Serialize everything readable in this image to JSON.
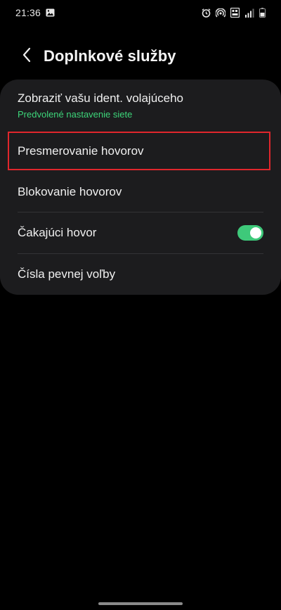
{
  "status_bar": {
    "time": "21:36",
    "icons_left": [
      "image-icon"
    ],
    "icons_right": [
      "alarm-icon",
      "hotspot-icon",
      "hd-voice-icon",
      "signal-icon",
      "battery-icon"
    ]
  },
  "header": {
    "title": "Doplnkové služby",
    "back_icon": "chevron-left-icon"
  },
  "settings": {
    "caller_id": {
      "label": "Zobraziť vašu ident. volajúceho",
      "sublabel": "Predvolené nastavenie siete"
    },
    "call_forwarding": {
      "label": "Presmerovanie hovorov"
    },
    "call_barring": {
      "label": "Blokovanie hovorov"
    },
    "call_waiting": {
      "label": "Čakajúci hovor",
      "enabled": true
    },
    "fixed_dialing": {
      "label": "Čísla pevnej voľby"
    }
  },
  "colors": {
    "accent_green": "#3ec97a",
    "sublabel_green": "#3dd67a",
    "highlight_red": "#e0262c",
    "card_bg": "#1c1c1e"
  }
}
